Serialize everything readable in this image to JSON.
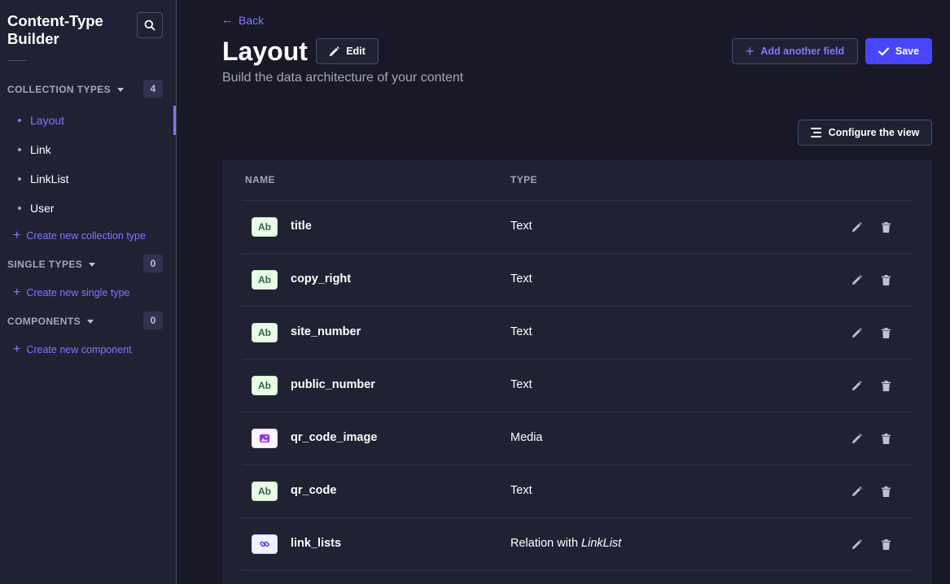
{
  "sidebar": {
    "title": "Content-Type Builder",
    "search_icon": "search-icon",
    "collection_types": {
      "label": "COLLECTION TYPES",
      "count": "4",
      "items": [
        {
          "label": "Layout",
          "active": true
        },
        {
          "label": "Link",
          "active": false
        },
        {
          "label": "LinkList",
          "active": false
        },
        {
          "label": "User",
          "active": false
        }
      ],
      "create_label": "Create new collection type"
    },
    "single_types": {
      "label": "SINGLE TYPES",
      "count": "0",
      "create_label": "Create new single type"
    },
    "components": {
      "label": "COMPONENTS",
      "count": "0",
      "create_label": "Create new component"
    }
  },
  "header": {
    "back_label": "Back",
    "title": "Layout",
    "edit_label": "Edit",
    "subtitle": "Build the data architecture of your content",
    "add_field_label": "Add another field",
    "save_label": "Save",
    "configure_label": "Configure the view"
  },
  "table": {
    "columns": [
      "NAME",
      "TYPE"
    ],
    "rows": [
      {
        "badge": "Ab",
        "badge_kind": "text",
        "name": "title",
        "type": "Text",
        "type_target": ""
      },
      {
        "badge": "Ab",
        "badge_kind": "text",
        "name": "copy_right",
        "type": "Text",
        "type_target": ""
      },
      {
        "badge": "Ab",
        "badge_kind": "text",
        "name": "site_number",
        "type": "Text",
        "type_target": ""
      },
      {
        "badge": "Ab",
        "badge_kind": "text",
        "name": "public_number",
        "type": "Text",
        "type_target": ""
      },
      {
        "badge": "",
        "badge_kind": "media",
        "name": "qr_code_image",
        "type": "Media",
        "type_target": ""
      },
      {
        "badge": "Ab",
        "badge_kind": "text",
        "name": "qr_code",
        "type": "Text",
        "type_target": ""
      },
      {
        "badge": "",
        "badge_kind": "relation",
        "name": "link_lists",
        "type": "Relation with ",
        "type_target": "LinkList"
      }
    ]
  },
  "colors": {
    "accent": "#7b79ff",
    "primary_button": "#4945ff",
    "background": "#181826",
    "surface": "#212134"
  }
}
